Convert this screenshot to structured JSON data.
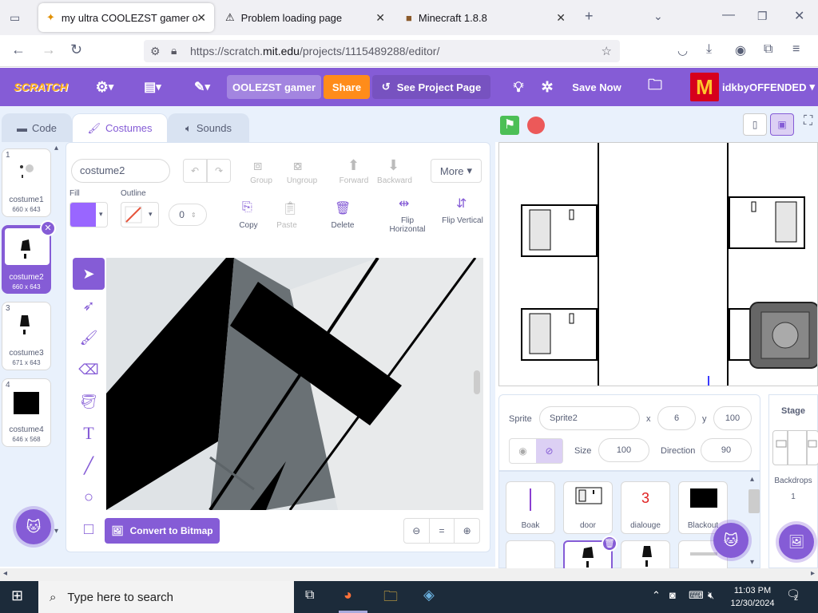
{
  "browser": {
    "tabs": [
      {
        "title": "my ultra COOLEZST gamer on S"
      },
      {
        "title": "Problem loading page"
      },
      {
        "title": "Minecraft 1.8.8"
      }
    ],
    "url_prefix": "https://scratch.",
    "url_domain": "mit.edu",
    "url_path": "/projects/1115489288/editor/"
  },
  "menubar": {
    "logo": "SCRATCH",
    "project_title": "OOLEZST gamer",
    "share": "Share",
    "see_project": "See Project Page",
    "save_now": "Save Now",
    "username": "idkbyOFFENDED",
    "accent": "#855cd6"
  },
  "editor_tabs": {
    "code": "Code",
    "costumes": "Costumes",
    "sounds": "Sounds"
  },
  "costumes": [
    {
      "num": "1",
      "name": "costume1",
      "size": "660 x 643"
    },
    {
      "num": "2",
      "name": "costume2",
      "size": "660 x 643"
    },
    {
      "num": "3",
      "name": "costume3",
      "size": "671 x 643"
    },
    {
      "num": "4",
      "name": "costume4",
      "size": "646 x 568"
    }
  ],
  "paint": {
    "costume_name": "costume2",
    "fill_label": "Fill",
    "outline_label": "Outline",
    "outline_width": "0",
    "group": "Group",
    "ungroup": "Ungroup",
    "forward": "Forward",
    "backward": "Backward",
    "more": "More",
    "copy": "Copy",
    "paste": "Paste",
    "delete": "Delete",
    "flip_h": "Flip Horizontal",
    "flip_v": "Flip Vertical",
    "convert": "Convert to Bitmap",
    "zoom_reset": "=",
    "fill_color": "#9966ff"
  },
  "sprite_info": {
    "sprite_label": "Sprite",
    "sprite_name": "Sprite2",
    "x_label": "x",
    "x": "6",
    "y_label": "y",
    "y": "100",
    "size_label": "Size",
    "size": "100",
    "direction_label": "Direction",
    "direction": "90"
  },
  "sprites": [
    {
      "name": "Boak"
    },
    {
      "name": "door"
    },
    {
      "name": "dialouge",
      "glyph": "3"
    },
    {
      "name": "Blackout"
    }
  ],
  "stage_pane": {
    "title": "Stage",
    "backdrops_label": "Backdrops",
    "backdrops_count": "1"
  },
  "taskbar": {
    "search": "Type here to search",
    "time": "11:03 PM",
    "date": "12/30/2024",
    "notifications": "2"
  }
}
